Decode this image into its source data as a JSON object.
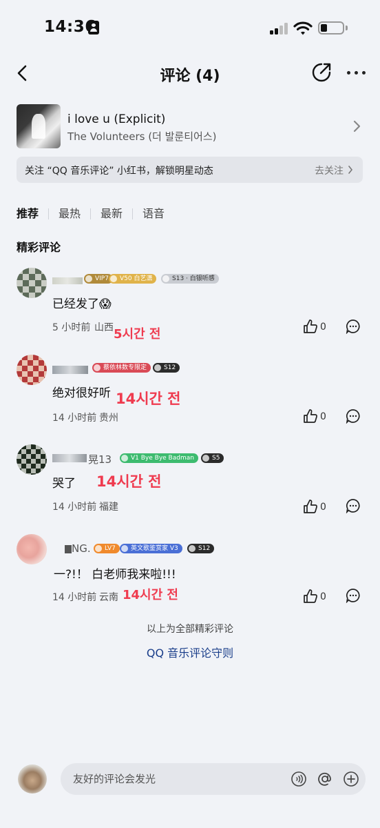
{
  "status_bar": {
    "time": "14:36"
  },
  "nav": {
    "title": "评论 (4)"
  },
  "song": {
    "title": "i love u (Explicit)",
    "artist": "The Volunteers (더 발룬티어스)"
  },
  "banner": {
    "text": "关注 “QQ 音乐评论” 小红书，解锁明星动态",
    "action": "去关注"
  },
  "tabs": [
    {
      "label": "推荐",
      "active": true
    },
    {
      "label": "最热",
      "active": false
    },
    {
      "label": "最新",
      "active": false
    },
    {
      "label": "语音",
      "active": false
    }
  ],
  "section_title": "精彩评论",
  "comments": [
    {
      "nickname": "VIP7",
      "badges": [
        "V50 白艺潇",
        "S13 · 白银听感"
      ],
      "text": "已经发了😱",
      "time": "5 小时前",
      "location": "山西",
      "overlay": "5시간 전",
      "likes": "0"
    },
    {
      "nickname": "",
      "badges": [
        "蔡依林数专限定",
        "S12"
      ],
      "text": "绝对很好听",
      "time": "14 小时前",
      "location": "贵州",
      "overlay": "14시간 전",
      "likes": "0"
    },
    {
      "nickname": "晃13",
      "badges": [
        "V1 Bye Bye Badman",
        "S5"
      ],
      "text": "哭了",
      "time": "14 小时前",
      "location": "福建",
      "overlay": "14시간 전",
      "likes": "0"
    },
    {
      "nickname": "NG.",
      "badges": [
        "LV7",
        "英文歌鉴赏家 V3",
        "S12"
      ],
      "text": "一?!！ 白老师我来啦!!!",
      "time": "14 小时前",
      "location": "云南",
      "overlay": "14시간 전",
      "likes": "0"
    }
  ],
  "footer": {
    "end_text": "以上为全部精彩评论",
    "rules_link": "QQ 音乐评论守则"
  },
  "input": {
    "placeholder": "友好的评论会发光"
  },
  "colors": {
    "background": "#f1f3f7",
    "overlay_red": "#ef3b4f",
    "link_blue": "#1a3e8a",
    "badge_gold": "#e0b34a",
    "badge_red": "#d94a56",
    "badge_green": "#3dbb6f",
    "badge_blue": "#4a6fd6",
    "badge_orange": "#f08a2c",
    "badge_dark": "#2b2b2b"
  }
}
